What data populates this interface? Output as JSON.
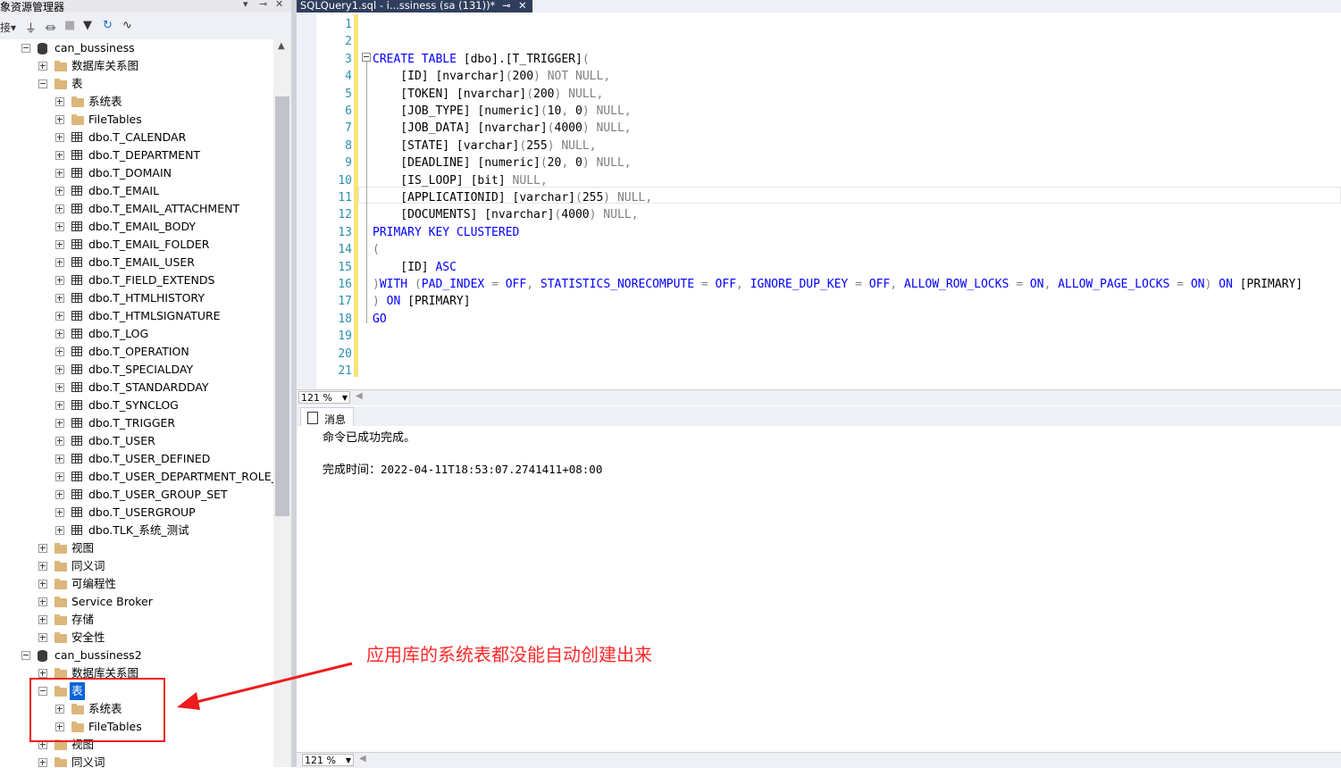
{
  "object_explorer": {
    "title": "象资源管理器",
    "connect_label": "接▾",
    "tree": [
      {
        "label": "can_bussiness",
        "type": "db",
        "expander": "minus",
        "level": 0
      },
      {
        "label": "数据库关系图",
        "type": "folder",
        "expander": "plus",
        "level": 1
      },
      {
        "label": "表",
        "type": "folder",
        "expander": "minus",
        "level": 1
      },
      {
        "label": "系统表",
        "type": "folder",
        "expander": "plus",
        "level": 2
      },
      {
        "label": "FileTables",
        "type": "folder",
        "expander": "plus",
        "level": 2
      },
      {
        "label": "dbo.T_CALENDAR",
        "type": "table",
        "expander": "plus",
        "level": 2
      },
      {
        "label": "dbo.T_DEPARTMENT",
        "type": "table",
        "expander": "plus",
        "level": 2
      },
      {
        "label": "dbo.T_DOMAIN",
        "type": "table",
        "expander": "plus",
        "level": 2
      },
      {
        "label": "dbo.T_EMAIL",
        "type": "table",
        "expander": "plus",
        "level": 2
      },
      {
        "label": "dbo.T_EMAIL_ATTACHMENT",
        "type": "table",
        "expander": "plus",
        "level": 2
      },
      {
        "label": "dbo.T_EMAIL_BODY",
        "type": "table",
        "expander": "plus",
        "level": 2
      },
      {
        "label": "dbo.T_EMAIL_FOLDER",
        "type": "table",
        "expander": "plus",
        "level": 2
      },
      {
        "label": "dbo.T_EMAIL_USER",
        "type": "table",
        "expander": "plus",
        "level": 2
      },
      {
        "label": "dbo.T_FIELD_EXTENDS",
        "type": "table",
        "expander": "plus",
        "level": 2
      },
      {
        "label": "dbo.T_HTMLHISTORY",
        "type": "table",
        "expander": "plus",
        "level": 2
      },
      {
        "label": "dbo.T_HTMLSIGNATURE",
        "type": "table",
        "expander": "plus",
        "level": 2
      },
      {
        "label": "dbo.T_LOG",
        "type": "table",
        "expander": "plus",
        "level": 2
      },
      {
        "label": "dbo.T_OPERATION",
        "type": "table",
        "expander": "plus",
        "level": 2
      },
      {
        "label": "dbo.T_SPECIALDAY",
        "type": "table",
        "expander": "plus",
        "level": 2
      },
      {
        "label": "dbo.T_STANDARDDAY",
        "type": "table",
        "expander": "plus",
        "level": 2
      },
      {
        "label": "dbo.T_SYNCLOG",
        "type": "table",
        "expander": "plus",
        "level": 2
      },
      {
        "label": "dbo.T_TRIGGER",
        "type": "table",
        "expander": "plus",
        "level": 2
      },
      {
        "label": "dbo.T_USER",
        "type": "table",
        "expander": "plus",
        "level": 2
      },
      {
        "label": "dbo.T_USER_DEFINED",
        "type": "table",
        "expander": "plus",
        "level": 2
      },
      {
        "label": "dbo.T_USER_DEPARTMENT_ROLE_SI",
        "type": "table",
        "expander": "plus",
        "level": 2
      },
      {
        "label": "dbo.T_USER_GROUP_SET",
        "type": "table",
        "expander": "plus",
        "level": 2
      },
      {
        "label": "dbo.T_USERGROUP",
        "type": "table",
        "expander": "plus",
        "level": 2
      },
      {
        "label": "dbo.TLK_系统_测试",
        "type": "table",
        "expander": "plus",
        "level": 2
      },
      {
        "label": "视图",
        "type": "folder",
        "expander": "plus",
        "level": 1
      },
      {
        "label": "同义词",
        "type": "folder",
        "expander": "plus",
        "level": 1
      },
      {
        "label": "可编程性",
        "type": "folder",
        "expander": "plus",
        "level": 1
      },
      {
        "label": "Service Broker",
        "type": "folder",
        "expander": "plus",
        "level": 1
      },
      {
        "label": "存储",
        "type": "folder",
        "expander": "plus",
        "level": 1
      },
      {
        "label": "安全性",
        "type": "folder",
        "expander": "plus",
        "level": 1
      },
      {
        "label": "can_bussiness2",
        "type": "db",
        "expander": "minus",
        "level": 0
      },
      {
        "label": "数据库关系图",
        "type": "folder",
        "expander": "plus",
        "level": 1
      },
      {
        "label": "表",
        "type": "folder",
        "expander": "minus",
        "level": 1,
        "selected": true
      },
      {
        "label": "系统表",
        "type": "folder",
        "expander": "plus",
        "level": 2
      },
      {
        "label": "FileTables",
        "type": "folder",
        "expander": "plus",
        "level": 2
      },
      {
        "label": "视图",
        "type": "folder",
        "expander": "plus",
        "level": 1
      },
      {
        "label": "同义词",
        "type": "folder",
        "expander": "plus",
        "level": 1
      }
    ]
  },
  "editor": {
    "tab_title": "SQLQuery1.sql - i...ssiness (sa (131))*",
    "tab_pin": "⊸",
    "tab_close": "✕",
    "line_numbers": [
      "1",
      "2",
      "3",
      "4",
      "5",
      "6",
      "7",
      "8",
      "9",
      "10",
      "11",
      "12",
      "13",
      "14",
      "15",
      "16",
      "17",
      "18",
      "19",
      "20",
      "21"
    ],
    "lines": [
      "",
      "",
      "CREATE TABLE [dbo].[T_TRIGGER](",
      "    [ID] [nvarchar](200) NOT NULL,",
      "    [TOKEN] [nvarchar](200) NULL,",
      "    [JOB_TYPE] [numeric](10, 0) NULL,",
      "    [JOB_DATA] [nvarchar](4000) NULL,",
      "    [STATE] [varchar](255) NULL,",
      "    [DEADLINE] [numeric](20, 0) NULL,",
      "    [IS_LOOP] [bit] NULL,",
      "    [APPLICATIONID] [varchar](255) NULL,",
      "    [DOCUMENTS] [nvarchar](4000) NULL,",
      "PRIMARY KEY CLUSTERED",
      "(",
      "    [ID] ASC",
      ")WITH (PAD_INDEX = OFF, STATISTICS_NORECOMPUTE = OFF, IGNORE_DUP_KEY = OFF, ALLOW_ROW_LOCKS = ON, ALLOW_PAGE_LOCKS = ON) ON [PRIMARY]",
      ") ON [PRIMARY]",
      "GO",
      "",
      "",
      ""
    ],
    "zoom_label": "121 %"
  },
  "results": {
    "tab_label": "消息",
    "message": "命令已成功完成。",
    "completion_label": "完成时间：",
    "completion_time": "2022-04-11T18:53:07.2741411+08:00",
    "zoom_label": "121 %"
  },
  "annotation": {
    "text": "应用库的系统表都没能自动创建出来",
    "color": "#ff2a2a"
  }
}
